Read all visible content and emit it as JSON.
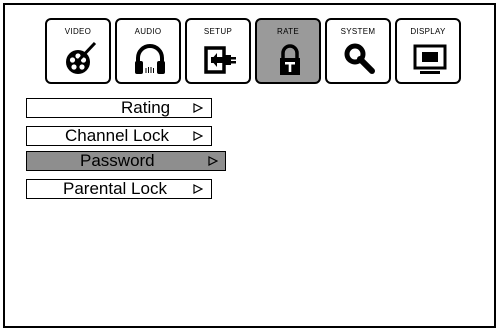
{
  "tabs": [
    {
      "label": "VIDEO",
      "icon": "video-reel-icon",
      "active": false
    },
    {
      "label": "AUDIO",
      "icon": "headphones-icon",
      "active": false
    },
    {
      "label": "SETUP",
      "icon": "setup-plug-icon",
      "active": false
    },
    {
      "label": "RATE",
      "icon": "padlock-icon",
      "active": true
    },
    {
      "label": "SYSTEM",
      "icon": "magnifier-icon",
      "active": false
    },
    {
      "label": "DISPLAY",
      "icon": "tv-screen-icon",
      "active": false
    }
  ],
  "menu": [
    {
      "label": "Rating",
      "selected": false
    },
    {
      "label": "Channel Lock",
      "selected": false
    },
    {
      "label": "Password",
      "selected": true
    },
    {
      "label": "Parental Lock",
      "selected": false
    }
  ],
  "colors": {
    "active_fill": "#9a9a9a",
    "selected_fill": "#8e8e8e",
    "border": "#000000"
  }
}
